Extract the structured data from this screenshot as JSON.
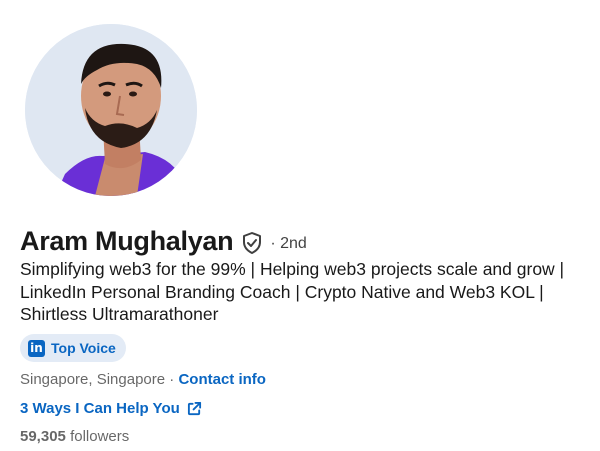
{
  "profile": {
    "name": "Aram Mughalyan",
    "degree_separator": "·",
    "degree": "2nd",
    "headline": "Simplifying web3 for the 99% | Helping web3 projects scale and grow | LinkedIn Personal Branding Coach | Crypto Native and Web3 KOL | Shirtless Ultramarathoner",
    "badge": {
      "icon": "linkedin-icon",
      "icon_text": "in",
      "label": "Top Voice"
    },
    "location": "Singapore, Singapore",
    "location_separator": " · ",
    "contact_link": "Contact info",
    "website_link": "3 Ways I Can Help You",
    "followers_count": "59,305",
    "followers_label": "followers"
  },
  "icons": {
    "verified": "verified-shield-icon",
    "external": "external-link-icon"
  },
  "colors": {
    "link": "#0a66c2",
    "badge_bg": "#e3ebf6",
    "avatar_bg": "#dfe7f2"
  }
}
